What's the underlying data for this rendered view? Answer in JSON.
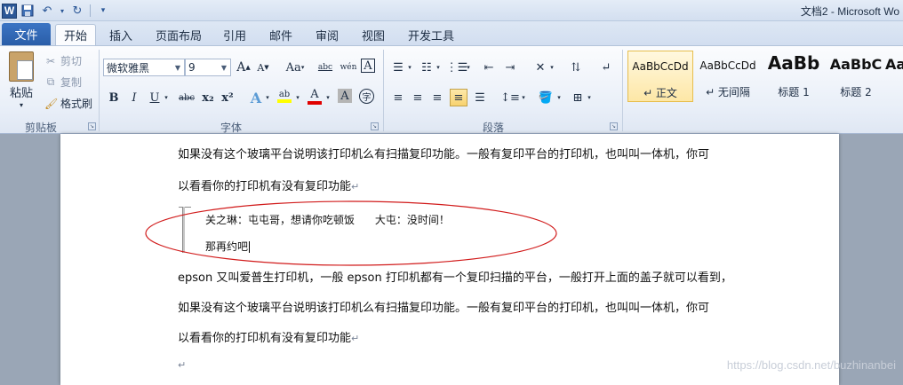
{
  "window": {
    "title": "文档2 - Microsoft Wo"
  },
  "qat": {
    "logo": "W",
    "icons": [
      "save-icon",
      "undo-icon",
      "redo-icon",
      "customize-icon"
    ]
  },
  "tabs": {
    "file": "文件",
    "items": [
      "开始",
      "插入",
      "页面布局",
      "引用",
      "邮件",
      "审阅",
      "视图",
      "开发工具"
    ],
    "active": "开始"
  },
  "clipboard": {
    "paste": "粘贴",
    "cut": "剪切",
    "copy": "复制",
    "format_painter": "格式刷",
    "group_label": "剪贴板"
  },
  "font": {
    "font_name": "微软雅黑",
    "font_size": "9",
    "grow": "A",
    "shrink": "A",
    "change_case": "Aa",
    "clear": "abc",
    "wen": "wén",
    "border_char": "A",
    "bold": "B",
    "italic": "I",
    "underline": "U",
    "strike": "abc",
    "subscript": "x₂",
    "superscript": "x²",
    "text_effect": "A",
    "highlight": "ab",
    "font_color": "A",
    "shading": "A",
    "enclose": "字",
    "group_label": "字体"
  },
  "paragraph": {
    "group_label": "段落"
  },
  "styles": [
    {
      "sample": "AaBbCcDd",
      "name": "↵ 正文",
      "selected": true
    },
    {
      "sample": "AaBbCcDd",
      "name": "↵ 无间隔",
      "selected": false
    },
    {
      "sample": "AaBb",
      "name": "标题 1",
      "selected": false
    },
    {
      "sample": "AaBbC",
      "name": "标题 2",
      "selected": false
    },
    {
      "sample": "Aa",
      "name": "",
      "selected": false
    }
  ],
  "document": {
    "lines": [
      "如果没有这个玻璃平台说明该打印机么有扫描复印功能。一般有复印平台的打印机，也叫叫一体机，你可",
      "以看看你的打印机有没有复印功能",
      "关之琳：屯屯哥，想请你吃顿饭      大屯：没时间！",
      "那再约吧",
      "epson 又叫爱普生打印机，一般 epson 打印机都有一个复印扫描的平台，一般打开上面的盖子就可以看到，",
      "如果没有这个玻璃平台说明该打印机么有扫描复印功能。一般有复印平台的打印机，也叫叫一体机，你可",
      "以看看你的打印机有没有复印功能",
      ""
    ],
    "para_mark": "↵"
  },
  "watermark": "https://blog.csdn.net/buzhinanbei",
  "colors": {
    "accent": "#2b5797",
    "highlight": "#f8d26f",
    "annotation": "#d11a1a",
    "font_color_bar": "#e00000",
    "highlight_bar": "#ffff00"
  }
}
